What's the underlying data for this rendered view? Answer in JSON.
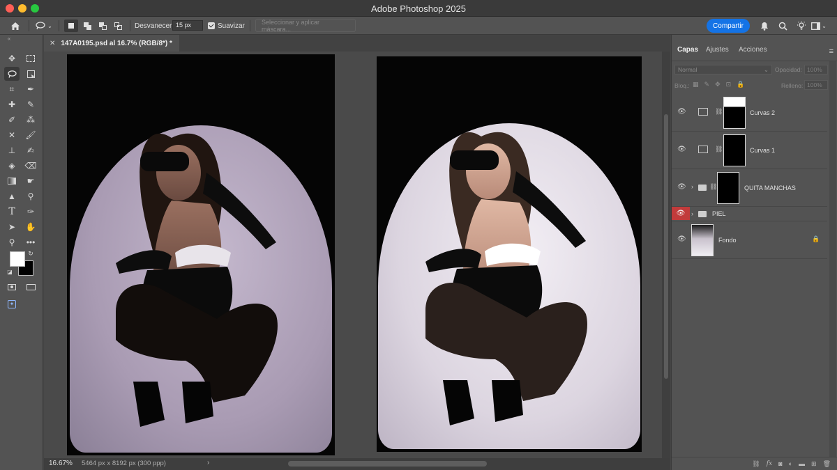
{
  "window": {
    "title": "Adobe Photoshop 2025"
  },
  "options_bar": {
    "feather_label": "Desvanecer:",
    "feather_value": "15 px",
    "antialias_label": "Suavizar",
    "select_mask_label": "Seleccionar y aplicar máscara...",
    "share_label": "Compartir"
  },
  "document": {
    "tab_title": "147A0195.psd al 16.7% (RGB/8*) *",
    "zoom": "16.67%",
    "size_info": "5464 px x 8192 px (300 ppp)"
  },
  "panel": {
    "tabs": [
      "Capas",
      "Ajustes",
      "Acciones"
    ],
    "blend_mode": "Normal",
    "opacity_label": "Opacidad:",
    "opacity_value": "100%",
    "lock_label": "Bloq.:",
    "fill_label": "Relleno:",
    "fill_value": "100%",
    "layers": [
      {
        "name": "Curvas 2",
        "kind": "adjustment"
      },
      {
        "name": "Curvas 1",
        "kind": "adjustment"
      },
      {
        "name": "QUITA MANCHAS",
        "kind": "group-masked"
      },
      {
        "name": "PIEL",
        "kind": "group"
      },
      {
        "name": "Fondo",
        "kind": "background"
      }
    ]
  },
  "icons": {
    "home": "home-icon",
    "lasso": "lasso-icon",
    "bell": "bell-icon",
    "search": "search-icon",
    "light": "lightbulb-icon",
    "workspace": "workspace-icon",
    "eye": "eye-icon",
    "lock": "lock-icon"
  },
  "colors": {
    "accent": "#1473e6",
    "visibility_highlight": "#c23b3b"
  }
}
